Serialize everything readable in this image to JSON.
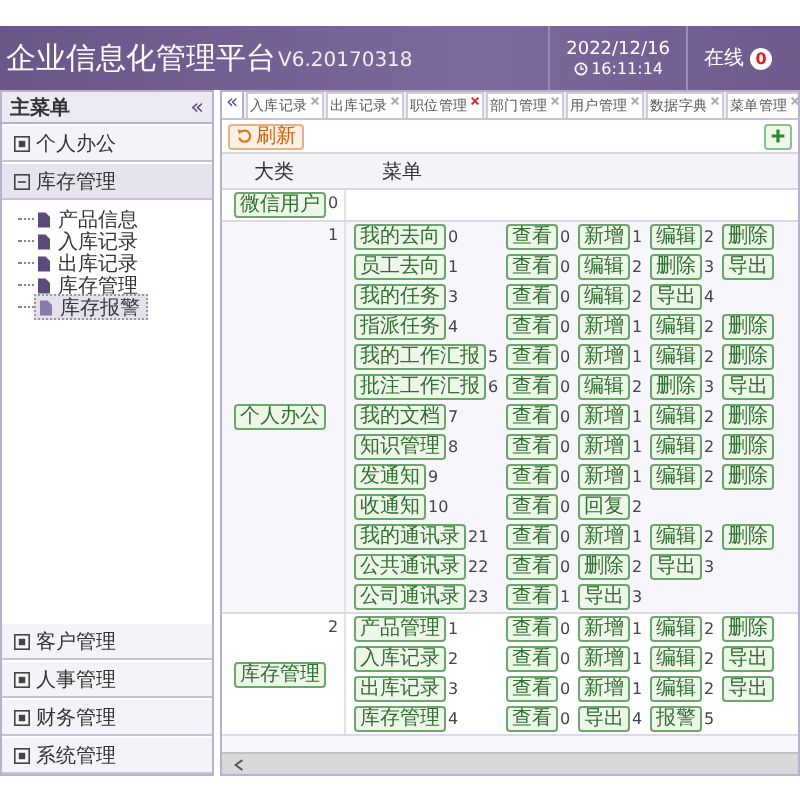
{
  "header": {
    "title": "企业信息化管理平台",
    "version": "V6.20170318",
    "date": "2022/12/16",
    "time": "16:11:14",
    "online_label": "在线",
    "online_count": "0"
  },
  "sidebar": {
    "title": "主菜单",
    "collapse": "«",
    "groups": [
      {
        "label": "个人办公",
        "expanded": false
      },
      {
        "label": "库存管理",
        "expanded": true,
        "children": [
          {
            "label": "产品信息",
            "selected": false
          },
          {
            "label": "入库记录",
            "selected": false
          },
          {
            "label": "出库记录",
            "selected": false
          },
          {
            "label": "库存管理",
            "selected": false
          },
          {
            "label": "库存报警",
            "selected": true
          }
        ]
      },
      {
        "label": "客户管理",
        "expanded": false
      },
      {
        "label": "人事管理",
        "expanded": false
      },
      {
        "label": "财务管理",
        "expanded": false
      },
      {
        "label": "系统管理",
        "expanded": false
      }
    ]
  },
  "tabs": {
    "scroll": "«",
    "items": [
      {
        "label": "入库记录",
        "hovered": false
      },
      {
        "label": "出库记录",
        "hovered": false
      },
      {
        "label": "职位管理",
        "hovered": true
      },
      {
        "label": "部门管理",
        "hovered": false
      },
      {
        "label": "用户管理",
        "hovered": false
      },
      {
        "label": "数据字典",
        "hovered": false
      },
      {
        "label": "菜单管理",
        "hovered": false
      }
    ]
  },
  "toolbar": {
    "refresh": "刷新"
  },
  "table": {
    "columns": [
      "大类",
      "菜单"
    ],
    "categories": [
      {
        "name": "微信用户",
        "code": "0"
      },
      {
        "name": "个人办公",
        "code": "1",
        "menus": [
          {
            "name": "我的去向",
            "code": "0",
            "actions": [
              {
                "label": "查看",
                "code": "0"
              },
              {
                "label": "新增",
                "code": "1"
              },
              {
                "label": "编辑",
                "code": "2"
              },
              {
                "label": "删除"
              }
            ]
          },
          {
            "name": "员工去向",
            "code": "1",
            "actions": [
              {
                "label": "查看",
                "code": "0"
              },
              {
                "label": "编辑",
                "code": "2"
              },
              {
                "label": "删除",
                "code": "3"
              },
              {
                "label": "导出"
              }
            ]
          },
          {
            "name": "我的任务",
            "code": "3",
            "actions": [
              {
                "label": "查看",
                "code": "0"
              },
              {
                "label": "编辑",
                "code": "2"
              },
              {
                "label": "导出",
                "code": "4"
              }
            ]
          },
          {
            "name": "指派任务",
            "code": "4",
            "actions": [
              {
                "label": "查看",
                "code": "0"
              },
              {
                "label": "新增",
                "code": "1"
              },
              {
                "label": "编辑",
                "code": "2"
              },
              {
                "label": "删除"
              }
            ]
          },
          {
            "name": "我的工作汇报",
            "code": "5",
            "actions": [
              {
                "label": "查看",
                "code": "0"
              },
              {
                "label": "新增",
                "code": "1"
              },
              {
                "label": "编辑",
                "code": "2"
              },
              {
                "label": "删除"
              }
            ]
          },
          {
            "name": "批注工作汇报",
            "code": "6",
            "actions": [
              {
                "label": "查看",
                "code": "0"
              },
              {
                "label": "编辑",
                "code": "2"
              },
              {
                "label": "删除",
                "code": "3"
              },
              {
                "label": "导出"
              }
            ]
          },
          {
            "name": "我的文档",
            "code": "7",
            "actions": [
              {
                "label": "查看",
                "code": "0"
              },
              {
                "label": "新增",
                "code": "1"
              },
              {
                "label": "编辑",
                "code": "2"
              },
              {
                "label": "删除"
              }
            ]
          },
          {
            "name": "知识管理",
            "code": "8",
            "actions": [
              {
                "label": "查看",
                "code": "0"
              },
              {
                "label": "新增",
                "code": "1"
              },
              {
                "label": "编辑",
                "code": "2"
              },
              {
                "label": "删除"
              }
            ]
          },
          {
            "name": "发通知",
            "code": "9",
            "actions": [
              {
                "label": "查看",
                "code": "0"
              },
              {
                "label": "新增",
                "code": "1"
              },
              {
                "label": "编辑",
                "code": "2"
              },
              {
                "label": "删除"
              }
            ]
          },
          {
            "name": "收通知",
            "code": "10",
            "actions": [
              {
                "label": "查看",
                "code": "0"
              },
              {
                "label": "回复",
                "code": "2"
              }
            ]
          },
          {
            "name": "我的通讯录",
            "code": "21",
            "actions": [
              {
                "label": "查看",
                "code": "0"
              },
              {
                "label": "新增",
                "code": "1"
              },
              {
                "label": "编辑",
                "code": "2"
              },
              {
                "label": "删除"
              }
            ]
          },
          {
            "name": "公共通讯录",
            "code": "22",
            "actions": [
              {
                "label": "查看",
                "code": "0"
              },
              {
                "label": "删除",
                "code": "2"
              },
              {
                "label": "导出",
                "code": "3"
              }
            ]
          },
          {
            "name": "公司通讯录",
            "code": "23",
            "actions": [
              {
                "label": "查看",
                "code": "1"
              },
              {
                "label": "导出",
                "code": "3"
              }
            ]
          }
        ]
      },
      {
        "name": "库存管理",
        "code": "2",
        "menus": [
          {
            "name": "产品管理",
            "code": "1",
            "actions": [
              {
                "label": "查看",
                "code": "0"
              },
              {
                "label": "新增",
                "code": "1"
              },
              {
                "label": "编辑",
                "code": "2"
              },
              {
                "label": "删除"
              }
            ]
          },
          {
            "name": "入库记录",
            "code": "2",
            "actions": [
              {
                "label": "查看",
                "code": "0"
              },
              {
                "label": "新增",
                "code": "1"
              },
              {
                "label": "编辑",
                "code": "2"
              },
              {
                "label": "导出"
              }
            ]
          },
          {
            "name": "出库记录",
            "code": "3",
            "actions": [
              {
                "label": "查看",
                "code": "0"
              },
              {
                "label": "新增",
                "code": "1"
              },
              {
                "label": "编辑",
                "code": "2"
              },
              {
                "label": "导出"
              }
            ]
          },
          {
            "name": "库存管理",
            "code": "4",
            "actions": [
              {
                "label": "查看",
                "code": "0"
              },
              {
                "label": "导出",
                "code": "4"
              },
              {
                "label": "报警",
                "code": "5"
              }
            ]
          }
        ]
      }
    ]
  }
}
